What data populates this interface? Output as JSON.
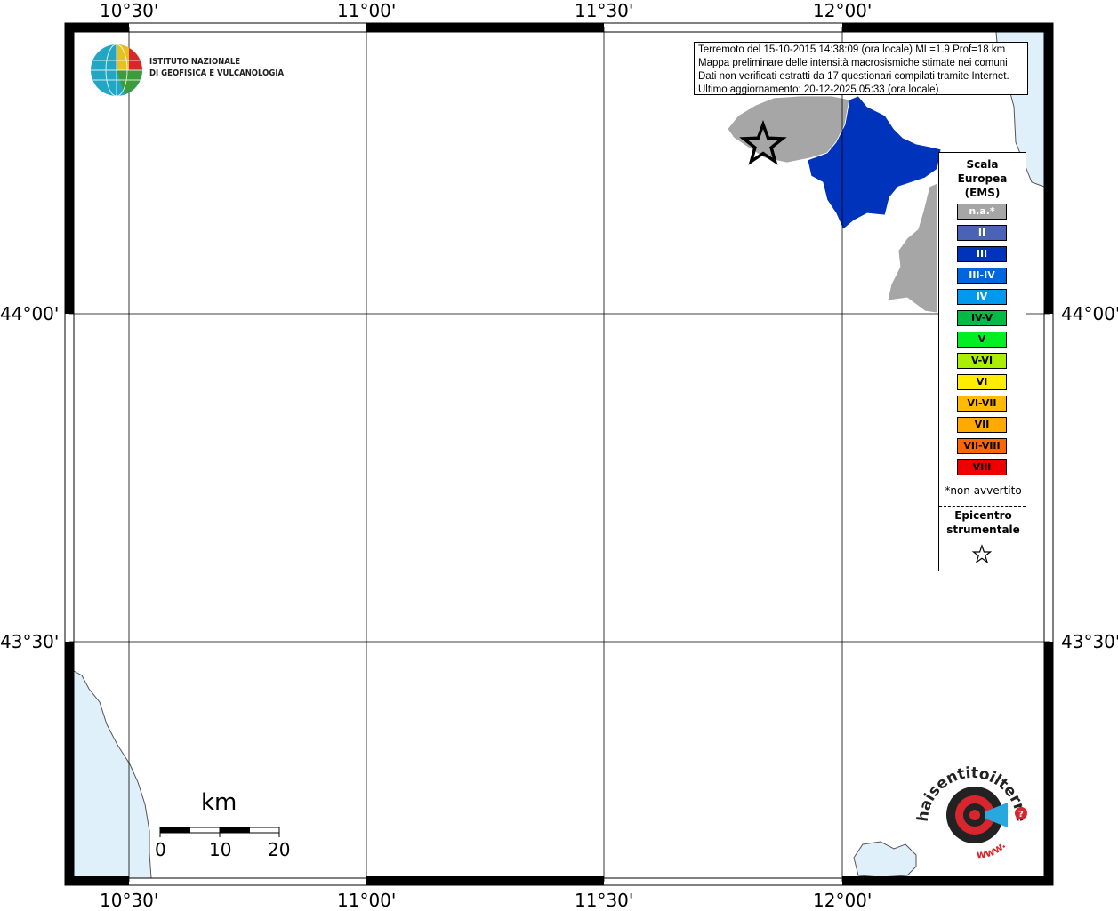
{
  "map": {
    "lon_labels": [
      "10°30'",
      "11°00'",
      "11°30'",
      "12°00'"
    ],
    "lat_labels": [
      "44°00'",
      "43°30'"
    ],
    "colors": {
      "sea": "#dff0fb",
      "not_felt": "#a6a6a6",
      "intensity_III": "#0033bb",
      "frame": "#000000"
    }
  },
  "logo": {
    "line1": "ISTITUTO NAZIONALE",
    "line2": "DI GEOFISICA E VULCANOLOGIA"
  },
  "info": {
    "line1": "Terremoto del 15-10-2015 14:38:09 (ora locale) ML=1.9 Prof=18 km",
    "line2": "Mappa preliminare delle intensità macrosismiche stimate nei comuni",
    "line3": "Dati non verificati estratti da 17 questionari compilati tramite Internet.",
    "line4": "Ultimo aggiornamento: 20-12-2025 05:33 (ora locale)"
  },
  "legend": {
    "title_line1": "Scala",
    "title_line2": "Europea",
    "title_line3": "(EMS)",
    "items": [
      {
        "label": "n.a.*",
        "color": "#a6a6a6",
        "text_color": "#ffffff"
      },
      {
        "label": "II",
        "color": "#4a63b4",
        "text_color": "#ffffff"
      },
      {
        "label": "III",
        "color": "#0033bb",
        "text_color": "#ffffff"
      },
      {
        "label": "III-IV",
        "color": "#0066dd",
        "text_color": "#ffffff"
      },
      {
        "label": "IV",
        "color": "#0099ee",
        "text_color": "#ffffff"
      },
      {
        "label": "IV-V",
        "color": "#00bb44",
        "text_color": "#000000"
      },
      {
        "label": "V",
        "color": "#00ee22",
        "text_color": "#000000"
      },
      {
        "label": "V-VI",
        "color": "#aaee00",
        "text_color": "#000000"
      },
      {
        "label": "VI",
        "color": "#ffee00",
        "text_color": "#000000"
      },
      {
        "label": "VI-VII",
        "color": "#ffbb00",
        "text_color": "#000000"
      },
      {
        "label": "VII",
        "color": "#ffaa00",
        "text_color": "#000000"
      },
      {
        "label": "VII-VIII",
        "color": "#ff6600",
        "text_color": "#000000"
      },
      {
        "label": "VIII",
        "color": "#ee0000",
        "text_color": "#000000"
      }
    ],
    "note": "*non avvertito",
    "epicenter_line1": "Epicentro",
    "epicenter_line2": "strumentale"
  },
  "scale_bar": {
    "unit": "km",
    "ticks": [
      "0",
      "10",
      "20"
    ]
  },
  "hsit_logo": {
    "text": "haisentitoilterremoto.it",
    "prefix": "www."
  }
}
